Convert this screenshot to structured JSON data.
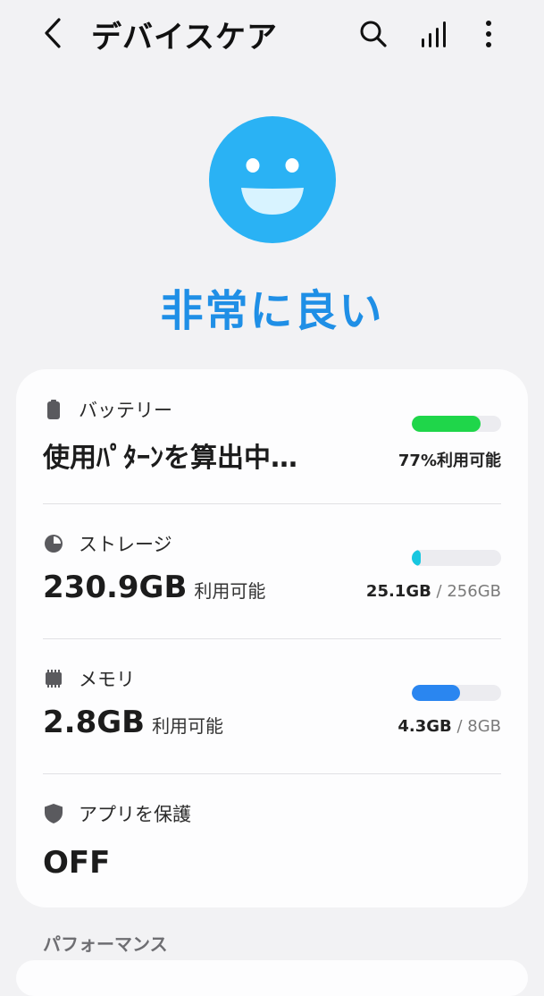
{
  "header": {
    "title": "デバイスケア",
    "icons": [
      "back-chevron-icon",
      "search-icon",
      "signal-bars-icon",
      "more-vert-icon"
    ]
  },
  "status": {
    "label": "非常に良い",
    "face_color": "#2ab2f4"
  },
  "items": [
    {
      "label": "バッテリー",
      "icon": "battery-icon",
      "value": "使用ﾊﾟﾀｰﾝを算出中…",
      "value_sub": "",
      "bar_fraction": 0.77,
      "bar_color": "#1fd64a",
      "caption_strong": "77%利用可能",
      "caption_muted": ""
    },
    {
      "label": "ストレージ",
      "icon": "storage-pie-icon",
      "value": "230.9GB",
      "value_sub": "利用可能",
      "bar_fraction": 0.1,
      "bar_color": "#18c7e0",
      "caption_strong": "25.1GB",
      "caption_muted": " / 256GB"
    },
    {
      "label": "メモリ",
      "icon": "memory-chip-icon",
      "value": "2.8GB",
      "value_sub": "利用可能",
      "bar_fraction": 0.54,
      "bar_color": "#2a86f0",
      "caption_strong": "4.3GB",
      "caption_muted": " / 8GB"
    },
    {
      "label": "アプリを保護",
      "icon": "shield-icon",
      "value": "OFF",
      "value_sub": ""
    }
  ],
  "section": {
    "title": "パフォーマンス"
  }
}
